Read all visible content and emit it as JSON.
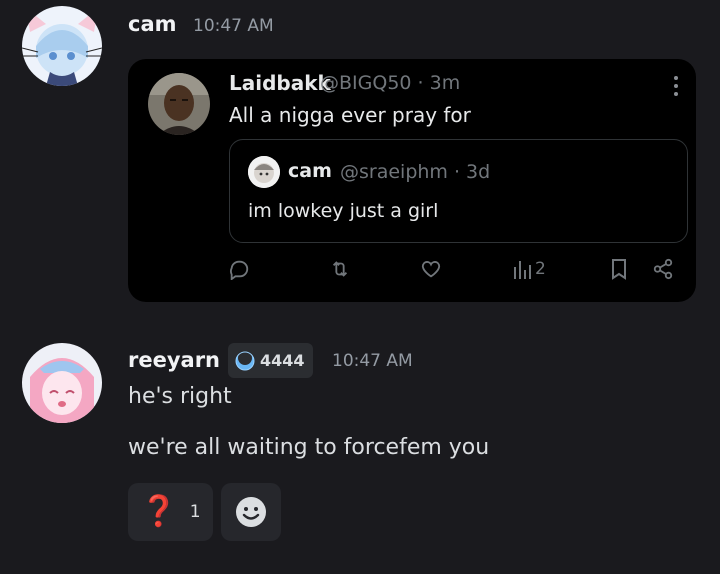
{
  "messages": [
    {
      "username": "cam",
      "timestamp": "10:47 AM"
    },
    {
      "username": "reeyarn",
      "timestamp": "10:47 AM",
      "badge": {
        "label": "4444"
      },
      "lines": [
        "he's right",
        "we're all waiting to forcefem you"
      ],
      "reactions": [
        {
          "emoji": "❓",
          "count": "1"
        }
      ]
    }
  ],
  "embed": {
    "author_name": "Laidbakk",
    "author_handle": "@BIGQ50 · 3m",
    "text": "All a nigga ever pray for",
    "quote": {
      "author_name": "cam",
      "author_handle": "@sraeiphm · 3d",
      "text": "im lowkey just a girl"
    },
    "views": "2"
  },
  "colors": {
    "background": "#1a1a1e",
    "embed_bg": "#000000",
    "muted": "#949ba4",
    "reaction_accent": "#e5303e"
  }
}
